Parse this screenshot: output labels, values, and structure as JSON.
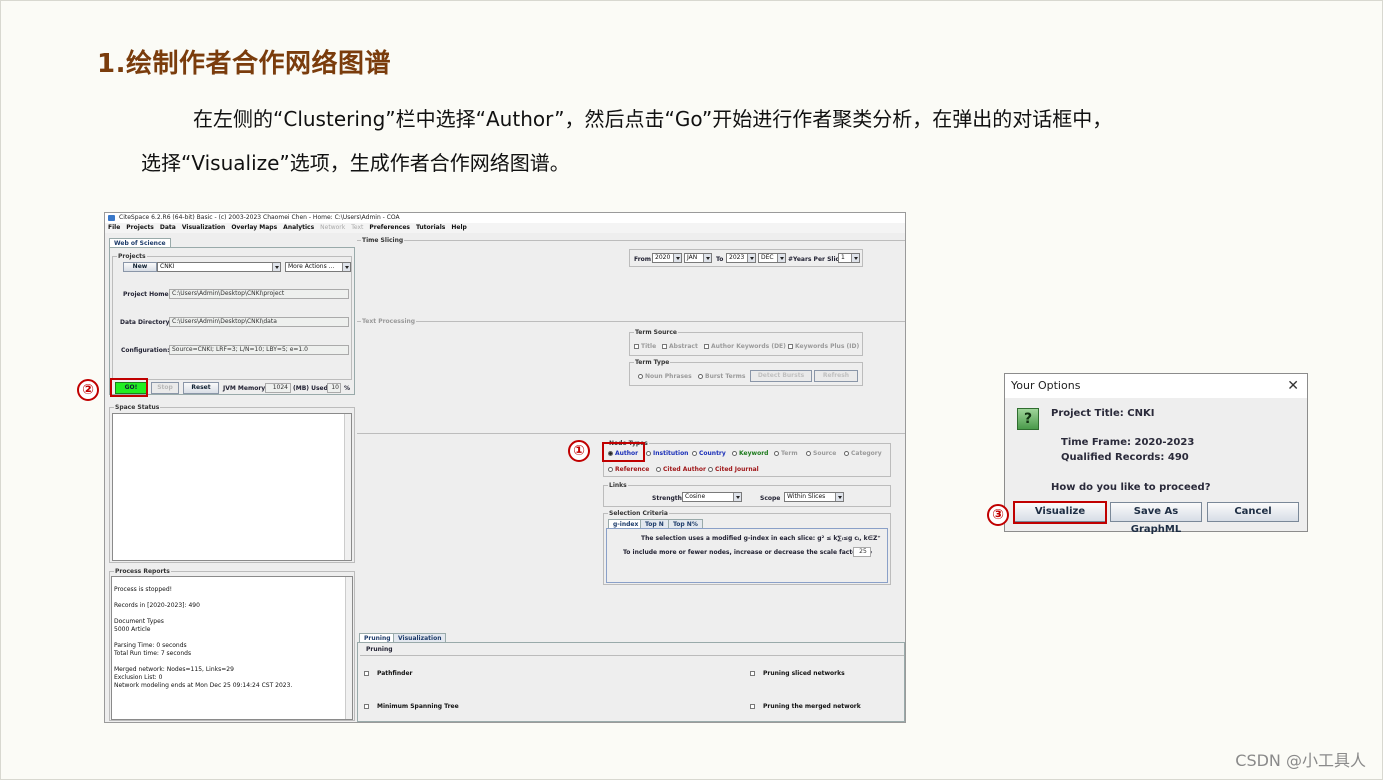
{
  "slide": {
    "heading": "1.绘制作者合作网络图谱",
    "paragraph_line1": "在左侧的“Clustering”栏中选择“Author”，然后点击“Go”开始进行作者聚类分析，在弹出的对话框中，",
    "paragraph_line2": "选择“Visualize”选项，生成作者合作网络图谱。",
    "watermark": "CSDN @小工具人",
    "badges": [
      "①",
      "②",
      "③"
    ]
  },
  "citespace": {
    "title": "CiteSpace 6.2.R6 (64-bit) Basic - (c) 2003-2023 Chaomei Chen - Home: C:\\Users\\Admin - COA",
    "menu": [
      "File",
      "Projects",
      "Data",
      "Visualization",
      "Overlay Maps",
      "Analytics",
      "Network",
      "Text",
      "Preferences",
      "Tutorials",
      "Help"
    ],
    "menu_dimmed": [
      "Network",
      "Text"
    ],
    "left": {
      "tab": "Web of Science",
      "projects_title": "Projects",
      "new_button": "New",
      "project_select": "CNKI",
      "more_actions": "More Actions ...",
      "project_home_label": "Project Home:",
      "project_home_value": "C:\\Users\\Admin\\Desktop\\CNKI\\project",
      "data_dir_label": "Data Directory:",
      "data_dir_value": "C:\\Users\\Admin\\Desktop\\CNKI\\data",
      "config_label": "Configuration:",
      "config_value": "Source=CNKI; LRF=3; L/N=10; LBY=5; e=1.0",
      "go_button": "GO!",
      "stop_button": "Stop",
      "reset_button": "Reset",
      "jvm_label": "JVM Memory",
      "jvm_value": "1024",
      "mb_used_label": "(MB) Used",
      "used_value": "10",
      "percent": "%",
      "space_status_title": "Space Status",
      "process_reports_title": "Process Reports",
      "process_reports_text": "Process is stopped!\n\nRecords in [2020-2023]: 490\n\nDocument Types\n5000    Article\n\nParsing Time:    0 seconds\nTotal Run time:  7 seconds\n\nMerged network: Nodes=115, Links=29\nExclusion List: 0\nNetwork modeling ends at Mon Dec 25 09:14:24 CST 2023."
    },
    "time_slicing": {
      "title": "Time Slicing",
      "from_label": "From",
      "from_year": "2020",
      "from_month": "JAN",
      "to_label": "To",
      "to_year": "2023",
      "to_month": "DEC",
      "years_per_slice_label": "#Years Per Slice",
      "years_per_slice": "1"
    },
    "text_processing": {
      "title": "Text Processing",
      "term_source_title": "Term Source",
      "term_sources": [
        "Title",
        "Abstract",
        "Author Keywords (DE)",
        "Keywords Plus (ID)"
      ],
      "term_type_title": "Term Type",
      "term_types": [
        "Noun Phrases",
        "Burst Terms"
      ],
      "detect_bursts": "Detect Bursts",
      "more_label": "Refresh"
    },
    "node_types": {
      "title": "Node Types",
      "row1": [
        "Author",
        "Institution",
        "Country",
        "Keyword",
        "Term",
        "Source",
        "Category"
      ],
      "row2": [
        "Reference",
        "Cited Author",
        "Cited Journal"
      ],
      "colors": {
        "Author": "#1a2fb8",
        "Institution": "#1a2fb8",
        "Country": "#1a2fb8",
        "Keyword": "#1c7a1c",
        "Term": "#9a9a9a",
        "Source": "#9a9a9a",
        "Category": "#9a9a9a",
        "Reference": "#a0181a",
        "Cited Author": "#a0181a",
        "Cited Journal": "#a0181a"
      }
    },
    "links": {
      "title": "Links",
      "strength_label": "Strength",
      "strength_value": "Cosine",
      "scope_label": "Scope",
      "scope_value": "Within Slices"
    },
    "selection": {
      "title": "Selection Criteria",
      "tabs": [
        "g-index",
        "Top N",
        "Top N%"
      ],
      "line1": "The selection uses a modified g-index in each slice: g² ≤ k∑ᵢ≤g cᵢ, k∈Z⁺",
      "line2": "To include more or fewer nodes, increase or decrease the scale factor k =",
      "k_value": "25"
    },
    "pruning": {
      "tabs": [
        "Pruning",
        "Visualization"
      ],
      "title": "Pruning",
      "options": [
        "Pathfinder",
        "Pruning sliced networks",
        "Minimum Spanning Tree",
        "Pruning the merged network"
      ]
    }
  },
  "dialog": {
    "title": "Your Options",
    "close": "✕",
    "icon": "?",
    "project_title": "Project Title: CNKI",
    "time_frame": "Time Frame: 2020-2023",
    "records": "Qualified Records: 490",
    "question": "How do you like to proceed?",
    "buttons": [
      "Visualize",
      "Save As GraphML",
      "Cancel"
    ]
  }
}
